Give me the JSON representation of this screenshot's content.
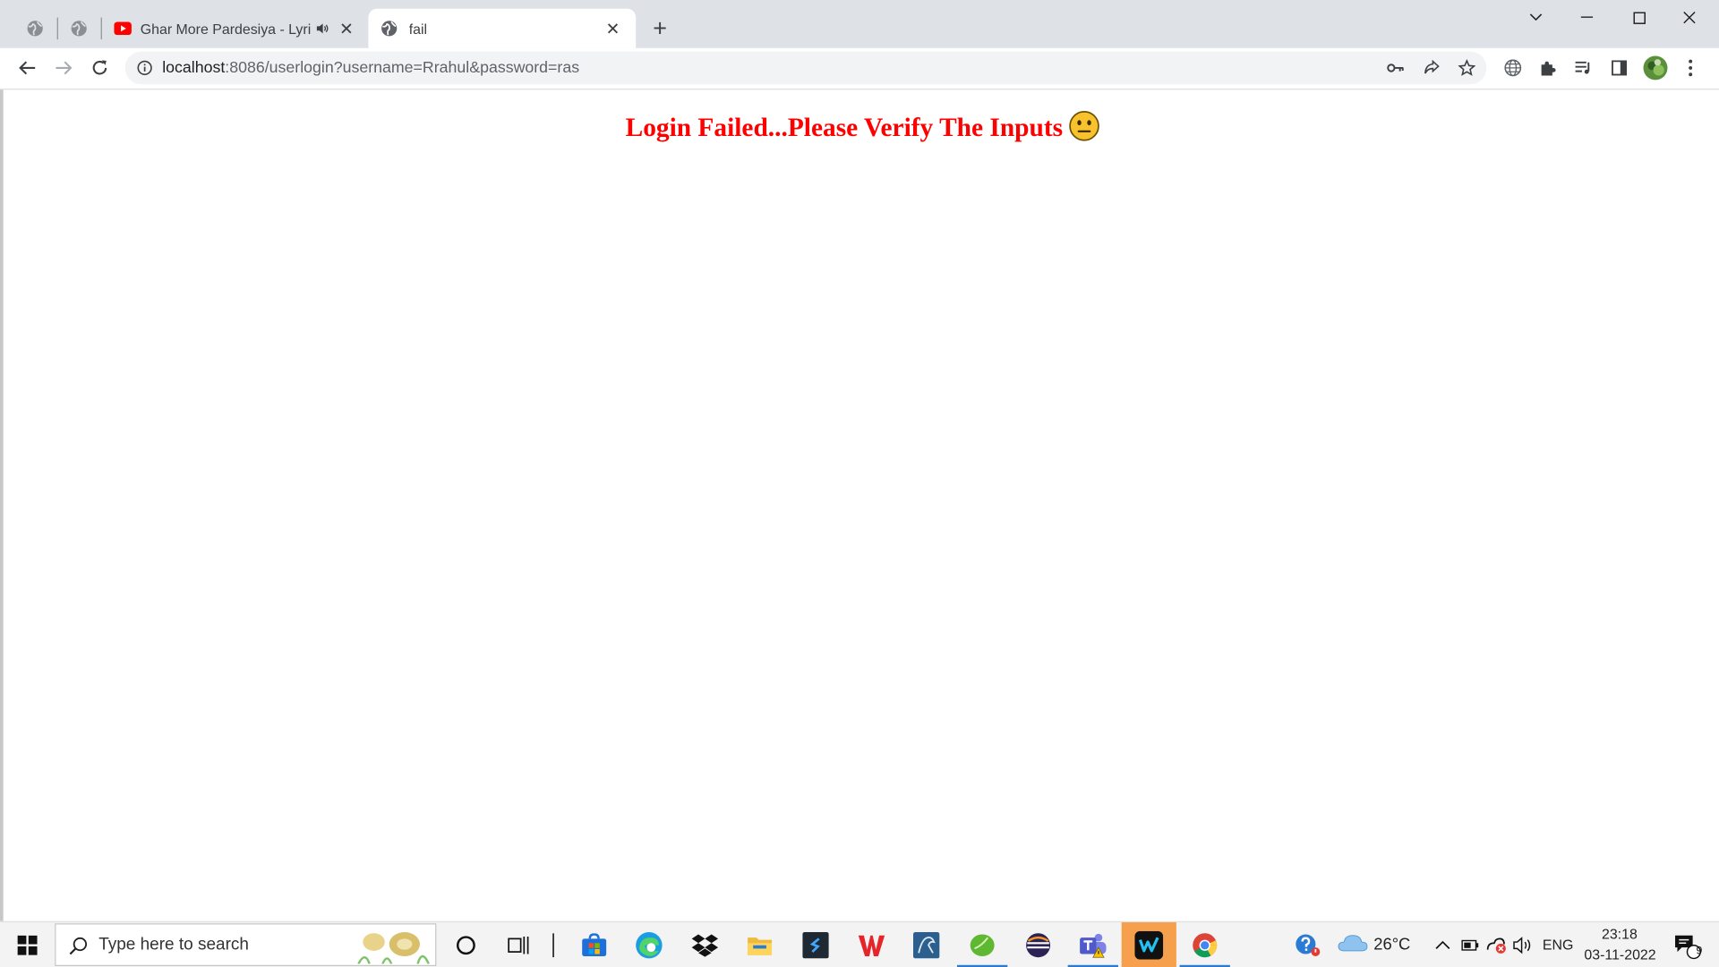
{
  "browser": {
    "tabs": [
      {
        "title": "Ghar More Pardesiya - Lyrical",
        "favicon": "youtube-icon",
        "audio": "speaker-icon"
      },
      {
        "title": "fail",
        "favicon": "globe-icon",
        "active": true
      }
    ],
    "new_tab_symbol": "+",
    "url_host": "localhost",
    "url_rest": ":8086/userlogin?username=Rrahul&password=ras"
  },
  "page": {
    "message": "Login Failed...Please Verify The Inputs",
    "emoji": "neutral-face"
  },
  "taskbar": {
    "search_placeholder": "Type here to search",
    "apps": [
      "cortana",
      "task-view",
      "microsoft-store",
      "edge",
      "dropbox",
      "file-explorer",
      "sublime-text",
      "wps-office",
      "mysql-workbench",
      "spring-tool-suite",
      "eclipse",
      "teams",
      "webex",
      "chrome"
    ],
    "weather_temp": "26°C",
    "language": "ENG",
    "time": "23:18",
    "date": "03-11-2022",
    "notification_count": "9"
  },
  "colors": {
    "message": "#ff0000",
    "tabstrip": "#dee1e6",
    "taskbar": "#f3f3f3",
    "active_indicator": "#2a7bd3"
  }
}
